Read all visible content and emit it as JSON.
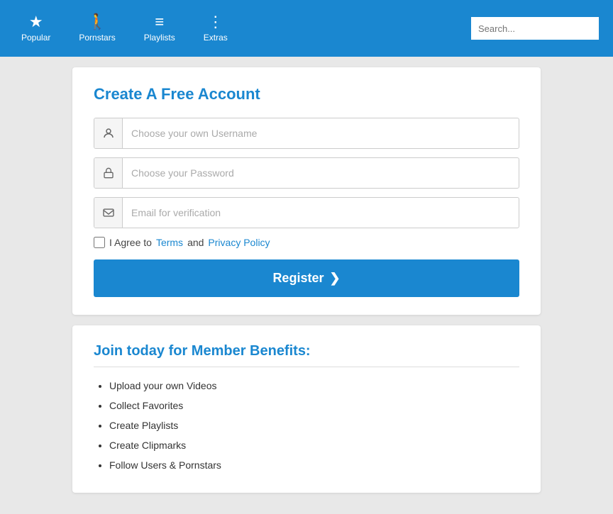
{
  "navbar": {
    "items": [
      {
        "id": "popular",
        "label": "Popular",
        "icon": "★"
      },
      {
        "id": "pornstars",
        "label": "Pornstars",
        "icon": "♀"
      },
      {
        "id": "playlists",
        "label": "Playlists",
        "icon": "≡"
      },
      {
        "id": "extras",
        "label": "Extras",
        "icon": "⋮"
      }
    ],
    "search_placeholder": "Search..."
  },
  "register_form": {
    "title": "Create A Free Account",
    "username_placeholder": "Choose your own Username",
    "password_placeholder": "Choose your Password",
    "email_placeholder": "Email for verification",
    "agree_text": "I Agree to",
    "terms_label": "Terms",
    "and_text": "and",
    "privacy_label": "Privacy Policy",
    "register_label": "Register",
    "register_arrow": "❯"
  },
  "benefits": {
    "title": "Join today for Member Benefits:",
    "items": [
      "Upload your own Videos",
      "Collect Favorites",
      "Create Playlists",
      "Create Clipmarks",
      "Follow Users & Pornstars"
    ]
  }
}
